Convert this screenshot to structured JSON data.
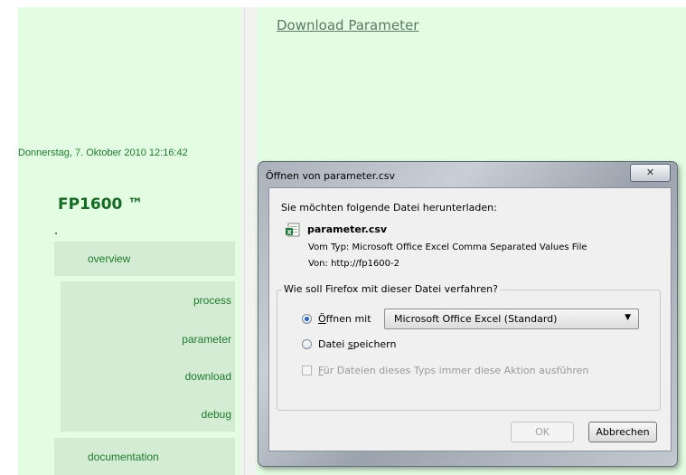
{
  "sidebar": {
    "datetime": "Donnerstag, 7. Oktober 2010 12:16:42",
    "brand": "FP1600 ™",
    "nav": [
      {
        "label": "overview"
      },
      {
        "label": "documentation"
      }
    ],
    "sub_items": [
      {
        "label": "process"
      },
      {
        "label": "parameter"
      },
      {
        "label": "download"
      },
      {
        "label": "debug"
      }
    ]
  },
  "main": {
    "link": "Download Parameter"
  },
  "dialog": {
    "title": "Öffnen von parameter.csv",
    "close_label": "✕",
    "prompt": "Sie möchten folgende Datei herunterladen:",
    "file_icon": "excel-csv-icon",
    "file_name": "parameter.csv",
    "type_label": "Vom Typ:",
    "type_value": "Microsoft Office Excel Comma Separated Values File",
    "from_label": "Von:",
    "from_value": "http://fp1600-2",
    "group_title": "Wie soll Firefox mit dieser Datei verfahren?",
    "open_with_label_accel": "Ö",
    "open_with_label_rest": "ffnen mit",
    "open_with_app": "Microsoft Office Excel (Standard)",
    "save_label_pre": "Datei ",
    "save_label_accel": "s",
    "save_label_rest": "peichern",
    "always_accel": "F",
    "always_rest": "ür Dateien dieses Typs immer diese Aktion ausführen",
    "ok_label": "OK",
    "cancel_label": "Abbrechen",
    "selected_option": "open"
  },
  "colors": {
    "panel_bg": "#e3fde3",
    "nav_bg": "#d3ecd3",
    "nav_text": "#1d7a2c",
    "link": "#5a7a6a"
  }
}
